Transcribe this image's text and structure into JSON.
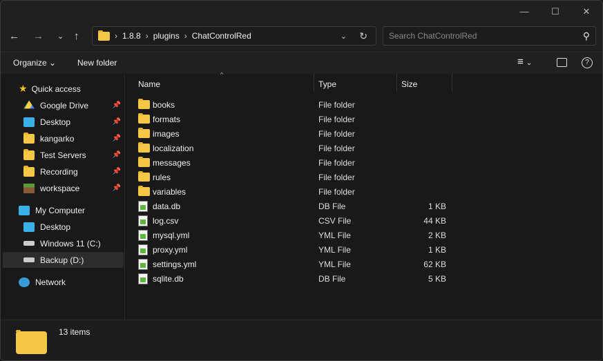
{
  "window": {
    "controls": {
      "minimize": "—",
      "maximize": "☐",
      "close": "✕"
    }
  },
  "address": {
    "crumbs": [
      "1.8.8",
      "plugins",
      "ChatControlRed"
    ]
  },
  "search": {
    "placeholder": "Search ChatControlRed"
  },
  "toolbar": {
    "organize": "Organize",
    "new_folder": "New folder"
  },
  "sidebar": {
    "quick_access": "Quick access",
    "pinned": [
      {
        "label": "Google Drive",
        "icon": "google-drive-icon"
      },
      {
        "label": "Desktop",
        "icon": "desktop-icon"
      },
      {
        "label": "kangarko",
        "icon": "folder-icon"
      },
      {
        "label": "Test Servers",
        "icon": "folder-icon"
      },
      {
        "label": "Recording",
        "icon": "folder-icon"
      },
      {
        "label": "workspace",
        "icon": "minecraft-block-icon"
      }
    ],
    "my_computer": "My Computer",
    "drives": [
      {
        "label": "Desktop",
        "icon": "desktop-icon"
      },
      {
        "label": "Windows 11 (C:)",
        "icon": "drive-icon"
      },
      {
        "label": "Backup (D:)",
        "icon": "drive-icon",
        "selected": true
      }
    ],
    "network": "Network"
  },
  "columns": {
    "name": "Name",
    "type": "Type",
    "size": "Size"
  },
  "files": [
    {
      "name": "books",
      "type": "File folder",
      "size": "",
      "kind": "folder"
    },
    {
      "name": "formats",
      "type": "File folder",
      "size": "",
      "kind": "folder"
    },
    {
      "name": "images",
      "type": "File folder",
      "size": "",
      "kind": "folder"
    },
    {
      "name": "localization",
      "type": "File folder",
      "size": "",
      "kind": "folder"
    },
    {
      "name": "messages",
      "type": "File folder",
      "size": "",
      "kind": "folder"
    },
    {
      "name": "rules",
      "type": "File folder",
      "size": "",
      "kind": "folder"
    },
    {
      "name": "variables",
      "type": "File folder",
      "size": "",
      "kind": "folder"
    },
    {
      "name": "data.db",
      "type": "DB File",
      "size": "1 KB",
      "kind": "file"
    },
    {
      "name": "log.csv",
      "type": "CSV File",
      "size": "44 KB",
      "kind": "file"
    },
    {
      "name": "mysql.yml",
      "type": "YML File",
      "size": "2 KB",
      "kind": "file"
    },
    {
      "name": "proxy.yml",
      "type": "YML File",
      "size": "1 KB",
      "kind": "file"
    },
    {
      "name": "settings.yml",
      "type": "YML File",
      "size": "62 KB",
      "kind": "file"
    },
    {
      "name": "sqlite.db",
      "type": "DB File",
      "size": "5 KB",
      "kind": "file"
    }
  ],
  "status": {
    "count": "13 items"
  }
}
